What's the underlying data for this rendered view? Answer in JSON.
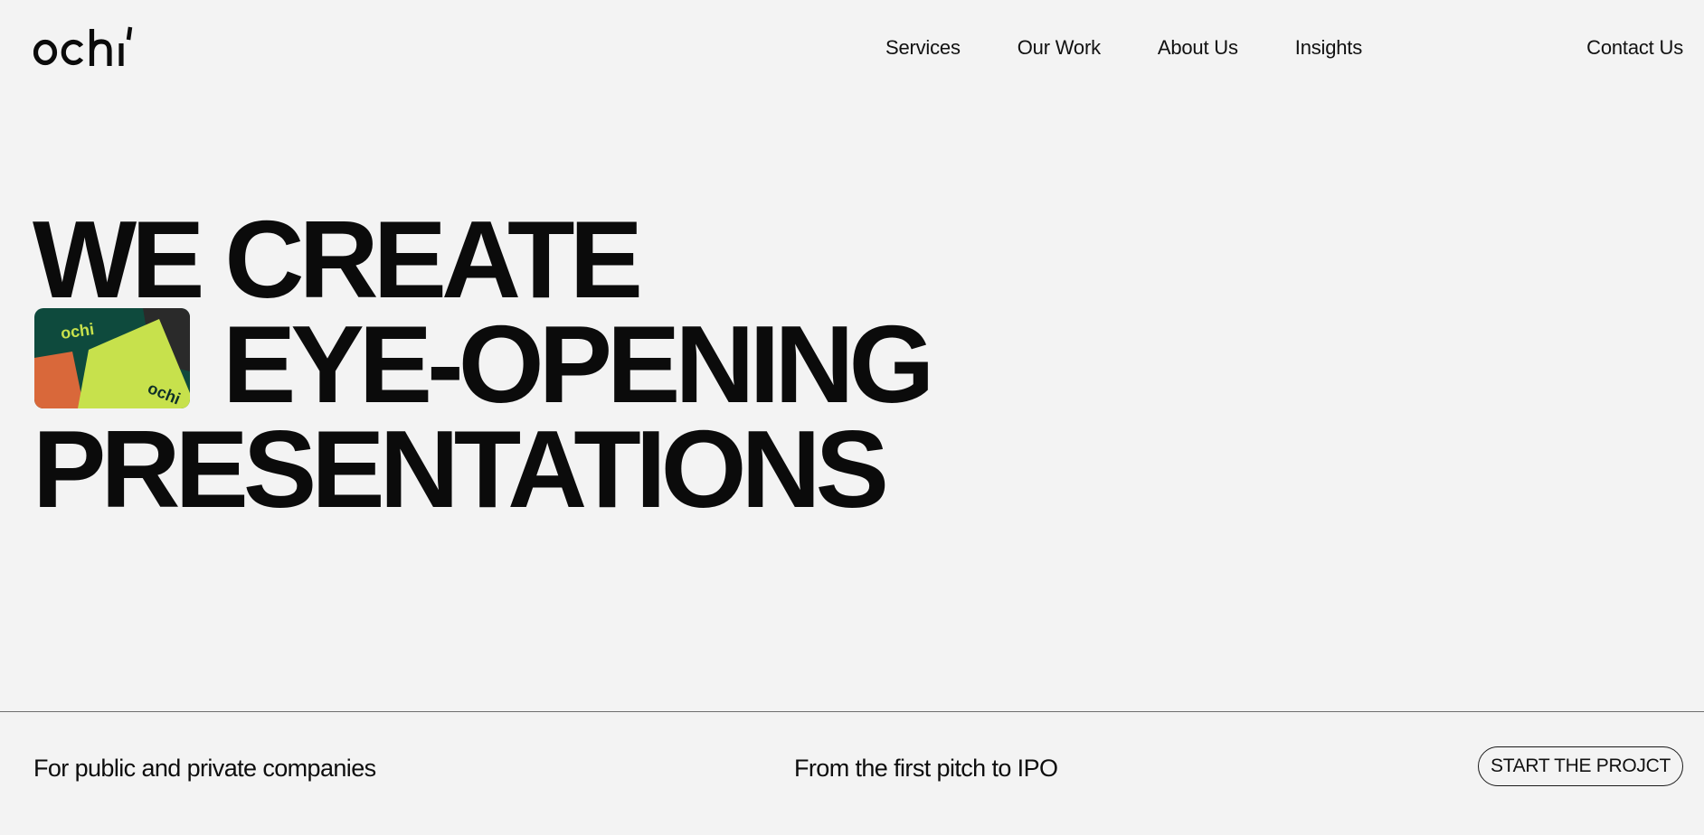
{
  "header": {
    "logo_text": "ochi",
    "nav": [
      {
        "label": "Services"
      },
      {
        "label": "Our Work"
      },
      {
        "label": "About Us"
      },
      {
        "label": "Insights"
      }
    ],
    "contact_label": "Contact Us"
  },
  "hero": {
    "line1": "WE CREATE",
    "line2": "EYE-OPENING",
    "line3": "PRESENTATIONS",
    "thumb_logo_text": "ochi",
    "colors": {
      "thumb_dark_green": "#0e4a3d",
      "thumb_lime": "#c7e14c",
      "thumb_orange": "#d9683a",
      "thumb_charcoal": "#2a2a2a"
    }
  },
  "footer_strip": {
    "left_text": "For public and private companies",
    "middle_text": "From the first pitch to IPO",
    "cta_label": "START THE PROJCT"
  },
  "colors": {
    "background": "#f3f3f3",
    "text": "#0b0b0b",
    "divider": "#6e6e6e"
  }
}
